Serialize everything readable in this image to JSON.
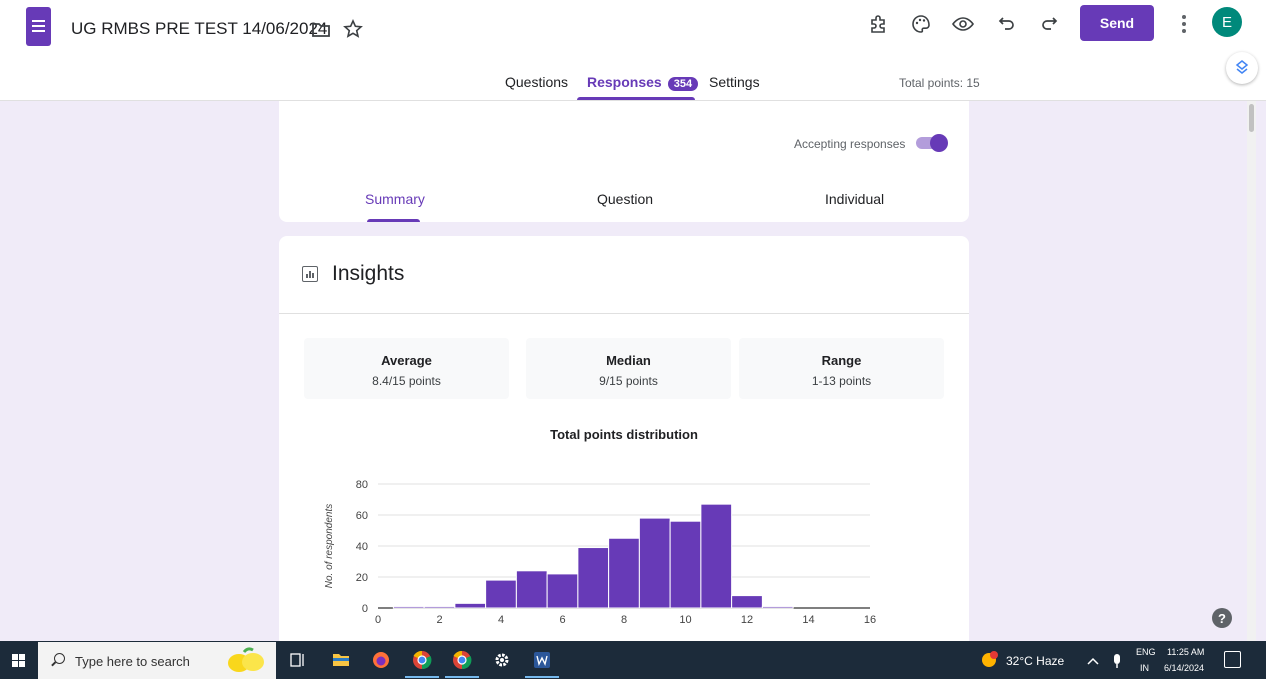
{
  "header": {
    "doc_title": "UG RMBS PRE TEST 14/06/2024",
    "send_label": "Send",
    "avatar_initial": "E",
    "icons": [
      "folder-icon",
      "star-icon",
      "addon-icon",
      "palette-icon",
      "preview-icon",
      "undo-icon",
      "redo-icon",
      "more-icon"
    ]
  },
  "main_tabs": {
    "questions": "Questions",
    "responses": "Responses",
    "responses_count": "354",
    "settings": "Settings",
    "total_points": "Total points: 15"
  },
  "responses_card": {
    "accepting_label": "Accepting responses",
    "accepting_on": true,
    "tabs": {
      "summary": "Summary",
      "question": "Question",
      "individual": "Individual"
    }
  },
  "insights": {
    "title": "Insights",
    "stats": {
      "average": {
        "label": "Average",
        "value": "8.4/15 points"
      },
      "median": {
        "label": "Median",
        "value": "9/15 points"
      },
      "range": {
        "label": "Range",
        "value": "1-13 points"
      }
    }
  },
  "chart_data": {
    "type": "bar",
    "title": "Total points distribution",
    "xlabel": "",
    "ylabel": "No. of respondents",
    "x": [
      1,
      2,
      3,
      4,
      5,
      6,
      7,
      8,
      9,
      10,
      11,
      12,
      13
    ],
    "values": [
      1,
      1,
      3,
      18,
      24,
      22,
      39,
      45,
      58,
      56,
      67,
      8,
      1
    ],
    "xlim": [
      0,
      16
    ],
    "ylim": [
      0,
      80
    ],
    "x_ticks": [
      "0",
      "2",
      "4",
      "6",
      "8",
      "10",
      "12",
      "14",
      "16"
    ],
    "y_ticks": [
      "0",
      "20",
      "40",
      "60",
      "80"
    ],
    "grid": true,
    "bar_color": "#673ab7"
  },
  "taskbar": {
    "search_placeholder": "Type here to search",
    "weather": "32°C  Haze",
    "lang_top": "ENG",
    "lang_bottom": "IN",
    "time": "11:25 AM",
    "date": "6/14/2024"
  },
  "colors": {
    "accent": "#673ab7",
    "background": "#f0ebf8"
  }
}
